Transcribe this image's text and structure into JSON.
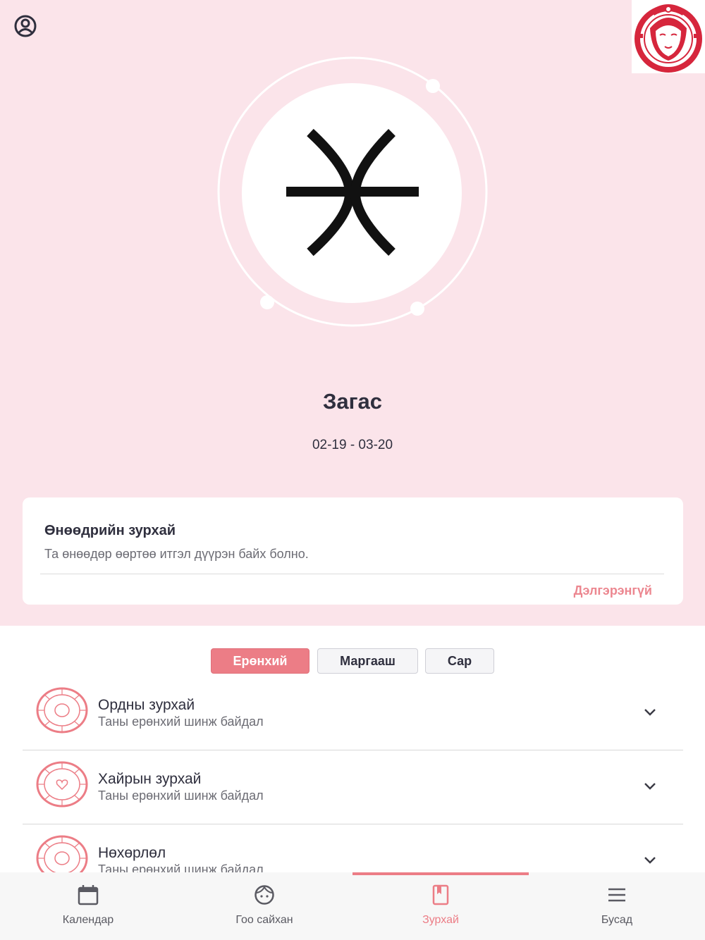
{
  "colors": {
    "hero_background": "#fbe4ea",
    "accent": "#ec7d86",
    "text_dark": "#2f2f3e",
    "text_muted": "#6b6b73",
    "tab_bar": "#f7f7f7"
  },
  "header": {
    "profile_icon": "user-circle-icon",
    "logo": "brand-girl-logo"
  },
  "zodiac": {
    "symbol_icon": "pisces-icon",
    "name": "Загас",
    "dates": "02-19 - 03-20"
  },
  "today": {
    "title": "Өнөөдрийн зурхай",
    "text": "Та өнөөдөр өөртөө итгэл дүүрэн байх болно.",
    "more_label": "Дэлгэрэнгүй"
  },
  "segments": {
    "items": [
      "Ерөнхий",
      "Маргааш",
      "Сар"
    ],
    "selected": "Ерөнхий"
  },
  "horoscope_list": [
    {
      "title": "Ордны зурхай",
      "subtitle": "Таны ерөнхий шинж байдал",
      "icon": "zodiac-wheel-icon"
    },
    {
      "title": "Хайрын зурхай",
      "subtitle": "Таны ерөнхий шинж байдал",
      "icon": "zodiac-wheel-heart-icon"
    },
    {
      "title": "Нөхөрлөл",
      "subtitle": "Таны ерөнхий шинж байдал",
      "icon": "zodiac-wheel-icon"
    }
  ],
  "tabbar": {
    "items": [
      {
        "label": "Календар",
        "icon": "calendar-icon"
      },
      {
        "label": "Гоо сайхан",
        "icon": "face-icon"
      },
      {
        "label": "Зурхай",
        "icon": "bookmark-book-icon"
      },
      {
        "label": "Бусад",
        "icon": "menu-icon"
      }
    ],
    "active": "Зурхай"
  }
}
